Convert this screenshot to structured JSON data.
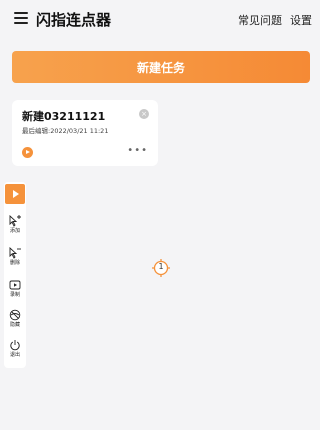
{
  "header": {
    "app_title": "闪指连点器",
    "faq_label": "常见问题",
    "settings_label": "设置"
  },
  "new_task_label": "新建任务",
  "tasks": [
    {
      "name": "新建03211121",
      "last_edited": "最后编辑:2022/03/21 11:21"
    }
  ],
  "toolbar": {
    "items": [
      {
        "icon": "add-pointer-icon",
        "label": "添加"
      },
      {
        "icon": "remove-pointer-icon",
        "label": "删除"
      },
      {
        "icon": "record-icon",
        "label": "录制"
      },
      {
        "icon": "hide-icon",
        "label": "隐藏"
      },
      {
        "icon": "power-icon",
        "label": "退出"
      }
    ]
  },
  "click_target": {
    "number": "1"
  },
  "colors": {
    "accent": "#f5923b",
    "background": "#f4f4f6"
  }
}
